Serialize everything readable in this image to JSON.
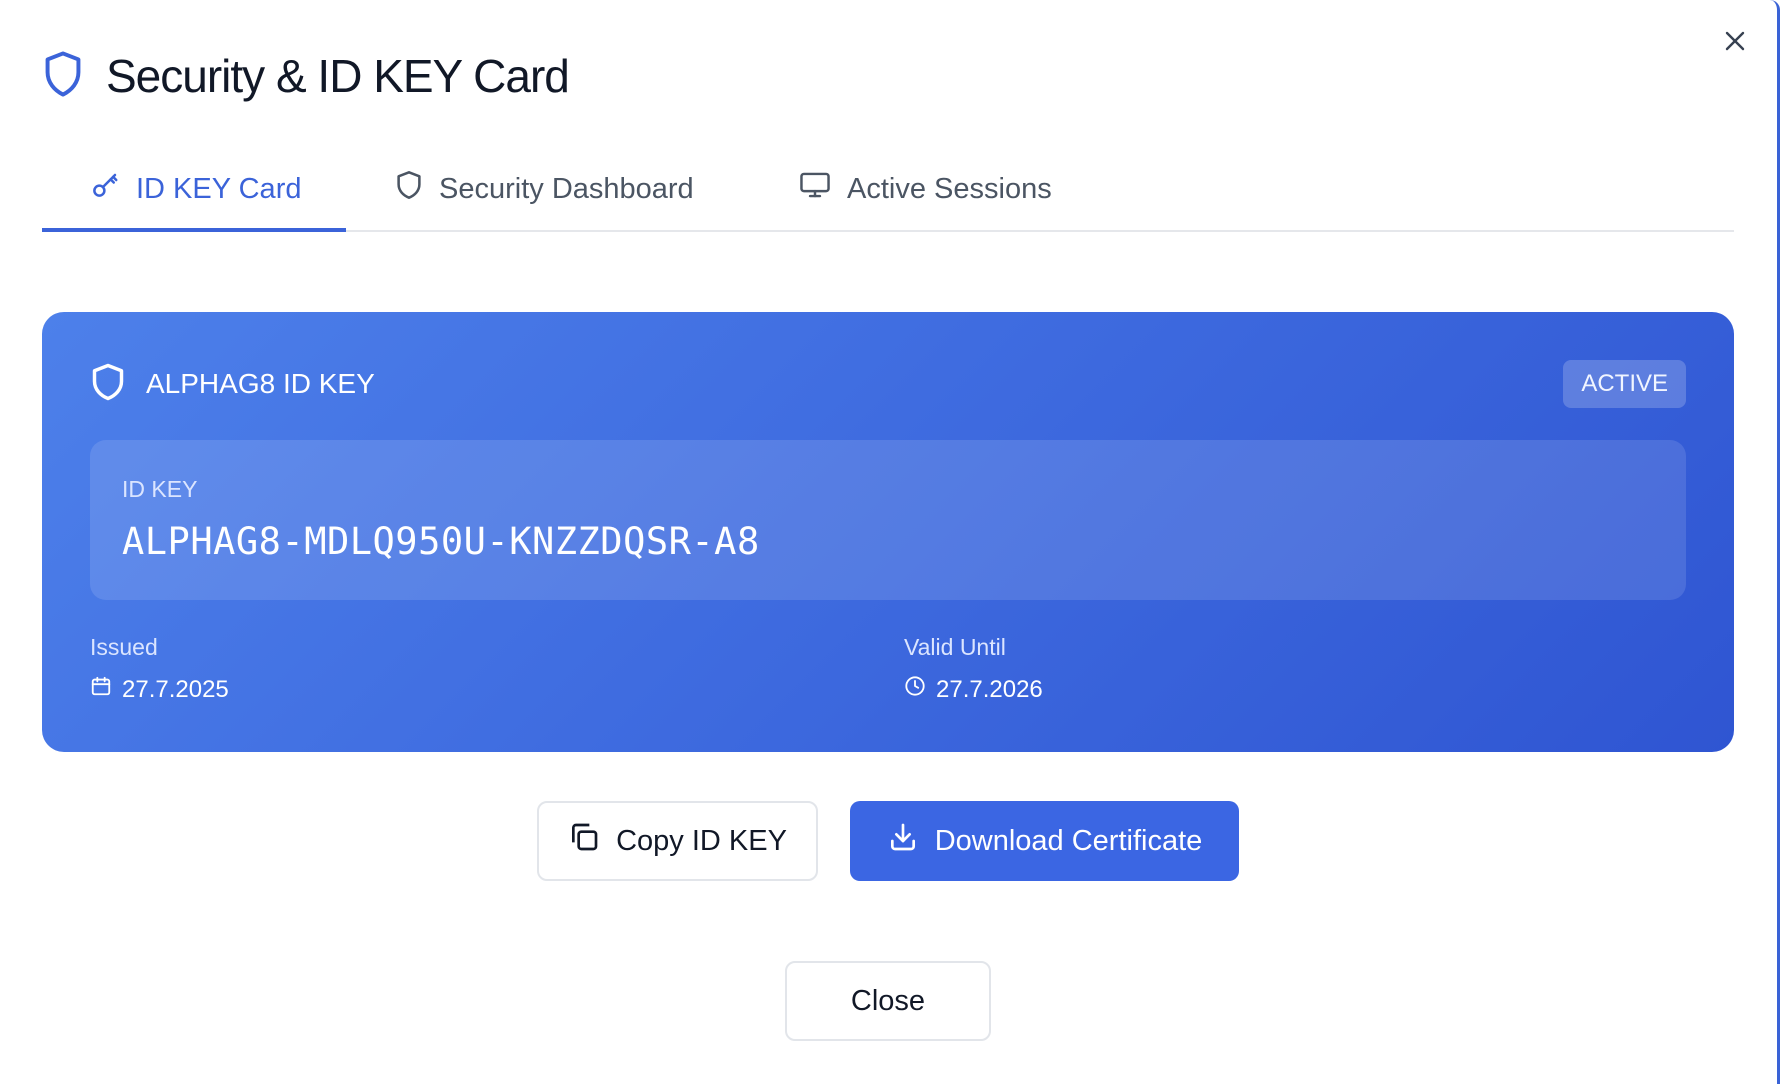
{
  "dialog": {
    "title": "Security & ID KEY Card",
    "close_icon": "close-icon"
  },
  "tabs": [
    {
      "label": "ID KEY Card",
      "icon": "key-icon",
      "active": true
    },
    {
      "label": "Security Dashboard",
      "icon": "shield-icon",
      "active": false
    },
    {
      "label": "Active Sessions",
      "icon": "monitor-icon",
      "active": false
    }
  ],
  "card": {
    "title": "ALPHAG8 ID KEY",
    "status": "ACTIVE",
    "key_label": "ID KEY",
    "key_value": "ALPHAG8-MDLQ950U-KNZZDQSR-A8",
    "issued_label": "Issued",
    "issued_value": "27.7.2025",
    "valid_label": "Valid Until",
    "valid_value": "27.7.2026"
  },
  "actions": {
    "copy_label": "Copy ID KEY",
    "download_label": "Download Certificate",
    "close_label": "Close"
  },
  "colors": {
    "accent": "#3b63d9",
    "card_gradient_start": "#4d80ea",
    "card_gradient_end": "#2f55d2",
    "primary_button": "#3b66e3"
  }
}
